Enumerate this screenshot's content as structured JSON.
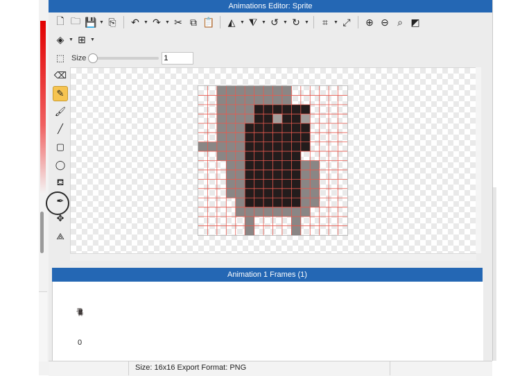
{
  "window": {
    "title": "Animations Editor: Sprite"
  },
  "toolbar": {
    "row1": [
      {
        "name": "new-file-button",
        "icon": "new-file-icon",
        "glyph": "🗋",
        "caret": false
      },
      {
        "name": "open-folder-button",
        "icon": "folder-icon",
        "glyph": "🗀",
        "caret": false
      },
      {
        "name": "save-button",
        "icon": "save-icon",
        "glyph": "💾",
        "caret": true
      },
      {
        "name": "export-button",
        "icon": "export-icon",
        "glyph": "⎘",
        "caret": false,
        "sep_after": true
      },
      {
        "name": "undo-button",
        "icon": "undo-icon",
        "glyph": "↶",
        "caret": true
      },
      {
        "name": "redo-button",
        "icon": "redo-icon",
        "glyph": "↷",
        "caret": true
      },
      {
        "name": "cut-button",
        "icon": "scissors-icon",
        "glyph": "✂",
        "caret": false
      },
      {
        "name": "copy-button",
        "icon": "copy-icon",
        "glyph": "⧉",
        "caret": false
      },
      {
        "name": "paste-button",
        "icon": "clipboard-icon",
        "glyph": "📋",
        "caret": false,
        "sep_after": true
      },
      {
        "name": "flip-horizontal-button",
        "icon": "flip-horizontal-icon",
        "glyph": "◭",
        "caret": true
      },
      {
        "name": "flip-vertical-button",
        "icon": "flip-vertical-icon",
        "glyph": "⧨",
        "caret": true
      },
      {
        "name": "rotate-left-button",
        "icon": "rotate-left-icon",
        "glyph": "↺",
        "caret": true
      },
      {
        "name": "rotate-right-button",
        "icon": "rotate-right-icon",
        "glyph": "↻",
        "caret": true,
        "sep_after": true
      },
      {
        "name": "crop-button",
        "icon": "crop-icon",
        "glyph": "⌗",
        "caret": true
      },
      {
        "name": "resize-button",
        "icon": "resize-arrows-icon",
        "glyph": "⤢",
        "caret": false,
        "sep_after": true
      },
      {
        "name": "zoom-in-button",
        "icon": "zoom-in-icon",
        "glyph": "⊕",
        "caret": false
      },
      {
        "name": "zoom-out-button",
        "icon": "zoom-out-icon",
        "glyph": "⊖",
        "caret": false
      },
      {
        "name": "zoom-fit-button",
        "icon": "zoom-fit-icon",
        "glyph": "⌕",
        "caret": false
      },
      {
        "name": "toggle-background-button",
        "icon": "background-toggle-icon",
        "glyph": "◩",
        "caret": false
      }
    ],
    "row2": [
      {
        "name": "layers-button",
        "icon": "layers-icon",
        "glyph": "◈",
        "caret": true
      },
      {
        "name": "grid-button",
        "icon": "grid-icon",
        "glyph": "⊞",
        "caret": true
      }
    ]
  },
  "brush": {
    "selection_glyph": "⬚",
    "size_label": "Size",
    "size_value": "1",
    "size_fraction": 0.0
  },
  "tools": [
    {
      "name": "eraser-tool",
      "icon": "eraser-icon",
      "glyph": "⌫",
      "active": false
    },
    {
      "name": "pencil-tool",
      "icon": "pencil-icon",
      "glyph": "✎",
      "active": true
    },
    {
      "name": "brush-tool",
      "icon": "paintbrush-icon",
      "glyph": "🖌",
      "active": false
    },
    {
      "name": "line-tool",
      "icon": "line-icon",
      "glyph": "╱",
      "active": false
    },
    {
      "name": "rectangle-tool",
      "icon": "rectangle-icon",
      "glyph": "▢",
      "active": false
    },
    {
      "name": "ellipse-tool",
      "icon": "ellipse-icon",
      "glyph": "◯",
      "active": false
    },
    {
      "name": "fill-tool",
      "icon": "paint-bucket-icon",
      "glyph": "⛾",
      "active": false
    },
    {
      "name": "eyedropper-tool",
      "icon": "eyedropper-icon",
      "glyph": "✒",
      "active": false
    },
    {
      "name": "move-tool",
      "icon": "move-icon",
      "glyph": "✥",
      "active": false
    },
    {
      "name": "nodes-tool",
      "icon": "nodes-icon",
      "glyph": "⟁",
      "active": false
    }
  ],
  "sprite": {
    "columns": 16,
    "rows": 16,
    "palette": {
      ".": "",
      "g": "#8a8685",
      "d": "#231c1c",
      "l": "#a39e9c"
    },
    "pixels": [
      "..gggggggg......",
      "..gggggggg......",
      "..ggggdddddd....",
      "..ggggddlddl....",
      "..gggddddddd....",
      "..gggddddddd....",
      "gggggddddddd....",
      "..gggdddddd.....",
      "...ggddddddgg...",
      "...ggddddddgg...",
      "...ggddddddgg...",
      "...ggddddddgg...",
      "....gddddddgg...",
      "....gggggggg....",
      ".....g....g.....",
      ".....g....g....."
    ],
    "grid_color": "#e85a4f"
  },
  "frames": {
    "header": "Animation 1 Frames (1)",
    "items": [
      {
        "index": "0"
      }
    ]
  },
  "status": {
    "text": "Size: 16x16   Export Format: PNG"
  }
}
